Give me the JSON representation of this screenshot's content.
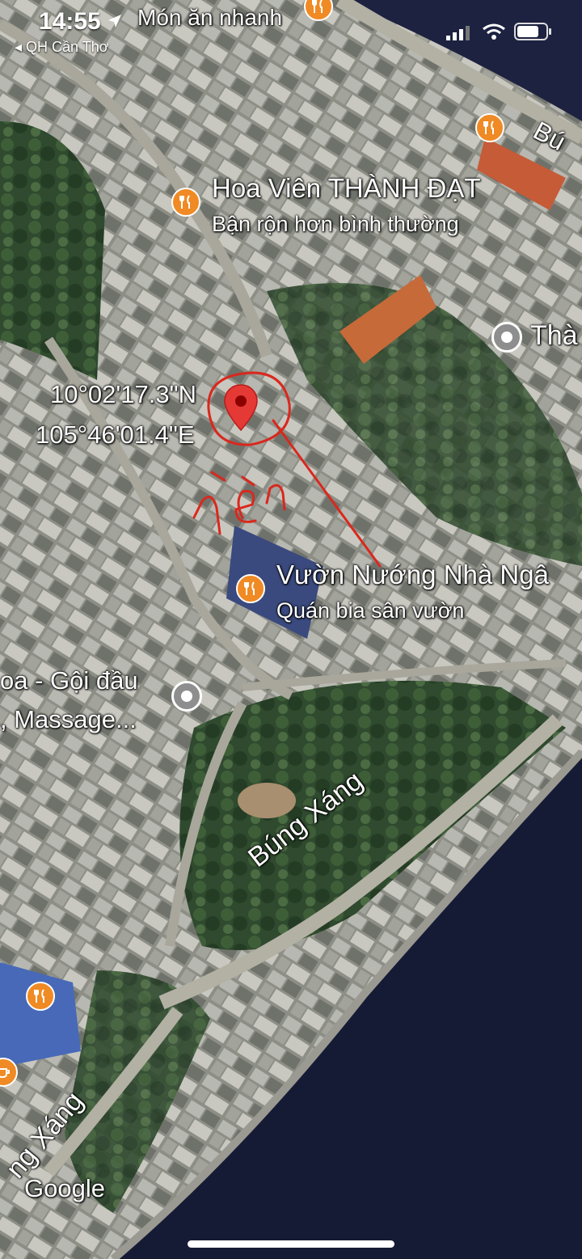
{
  "status_bar": {
    "time": "14:55",
    "back_label": "◂ QH Cần Thơ"
  },
  "map": {
    "type": "satellite",
    "pin": {
      "lat": "10°02'17.3\"N",
      "lng": "105°46'01.4\"E"
    },
    "handwritten_note": "nền",
    "attribution": "Google",
    "places": [
      {
        "id": "mon-an-nhanh",
        "name": "Món ăn nhanh",
        "icon": "restaurant-icon"
      },
      {
        "id": "hoa-vien",
        "name": "Hoa Viên THÀNH ĐẠT",
        "subtitle": "Bận rộn hơn bình thường",
        "icon": "restaurant-icon"
      },
      {
        "id": "vuon-nuong",
        "name": "Vườn Nướng Nhà Ngâ",
        "subtitle": "Quán bia sân vườn",
        "icon": "restaurant-icon"
      },
      {
        "id": "spa",
        "name": "oa - Gội đầu",
        "subtitle": ", Massage...",
        "icon": "place-icon"
      },
      {
        "id": "tha",
        "name": "Thà",
        "icon": "place-icon"
      }
    ],
    "roads": [
      "Búng Xáng",
      "Búng Xáng",
      "ng Xáng",
      "Bú"
    ]
  },
  "colors": {
    "poi": "#f08a24",
    "pin": "#e53935",
    "annotation": "#d9281e",
    "water": "#1a1f3a"
  }
}
